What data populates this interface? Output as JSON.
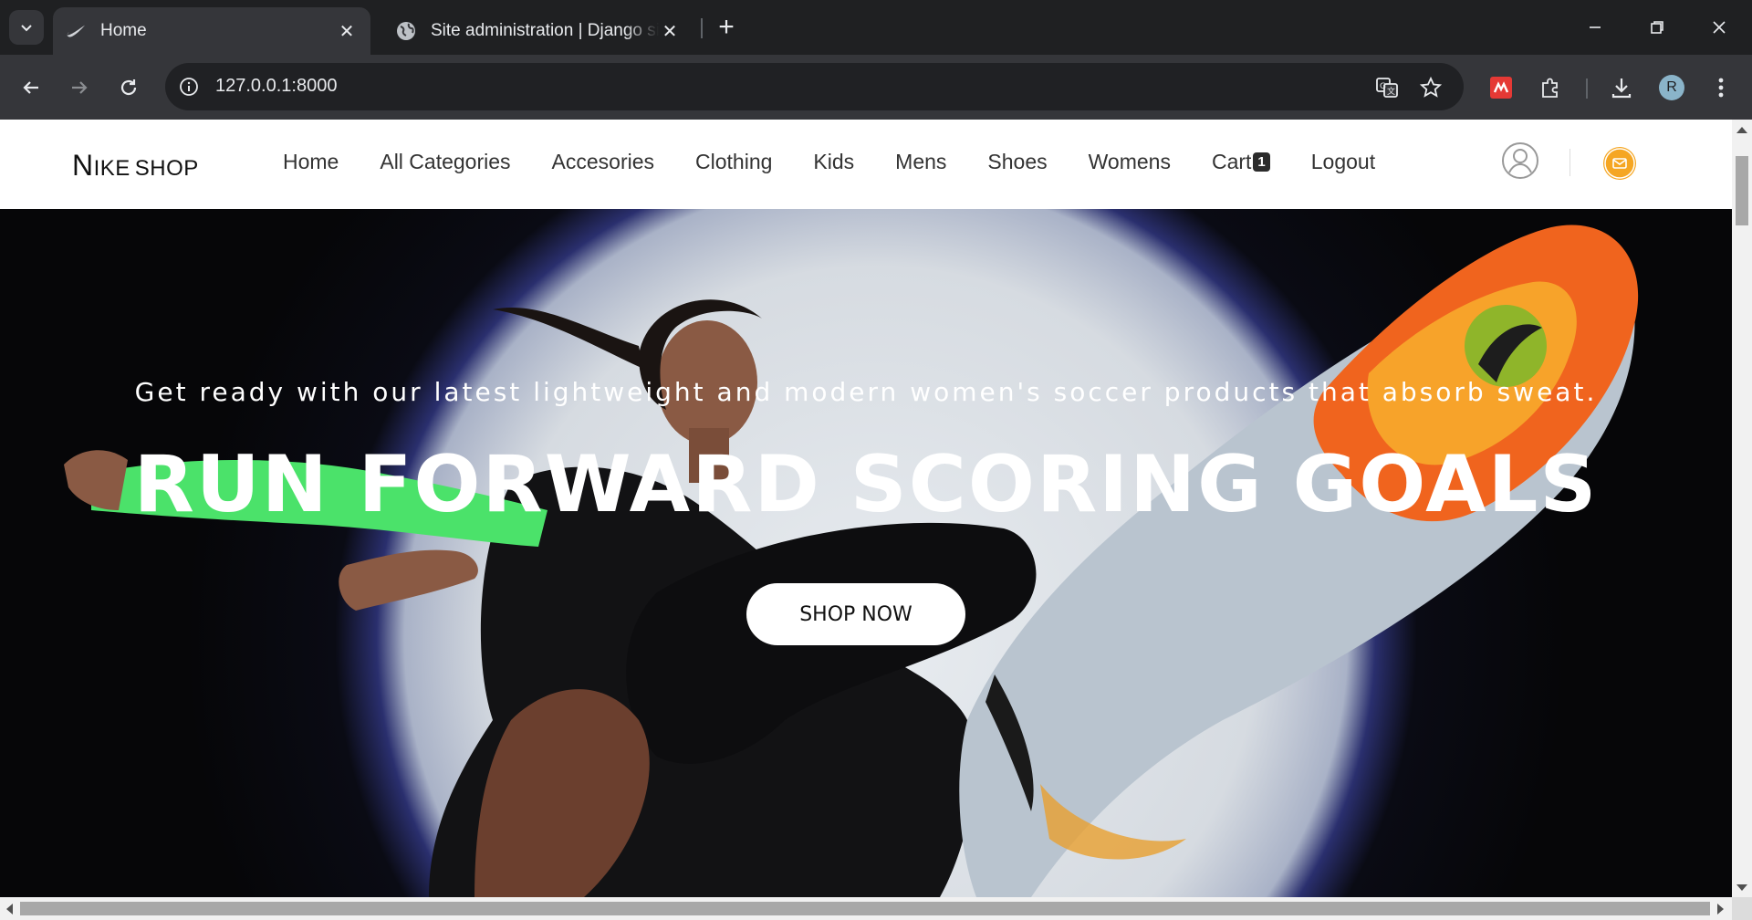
{
  "browser": {
    "tabs": [
      {
        "title": "Home",
        "active": true,
        "favicon": "nike-swoosh-icon"
      },
      {
        "title": "Site administration | Django site admin",
        "active": false,
        "favicon": "globe-icon"
      }
    ],
    "url": "127.0.0.1:8000",
    "profile_initial": "R"
  },
  "site": {
    "brand_big": "N",
    "brand_rest": "IKE",
    "brand_shop": "SHOP",
    "nav": [
      "Home",
      "All Categories",
      "Accesories",
      "Clothing",
      "Kids",
      "Mens",
      "Shoes",
      "Womens"
    ],
    "cart_label": "Cart",
    "cart_count": "1",
    "logout_label": "Logout",
    "accent_color": "#f5a623"
  },
  "hero": {
    "subtitle": "Get ready with our latest lightweight and modern women's soccer products that absorb sweat.",
    "title": "RUN FORWARD SCORING GOALS",
    "button_label": "SHOP NOW"
  }
}
